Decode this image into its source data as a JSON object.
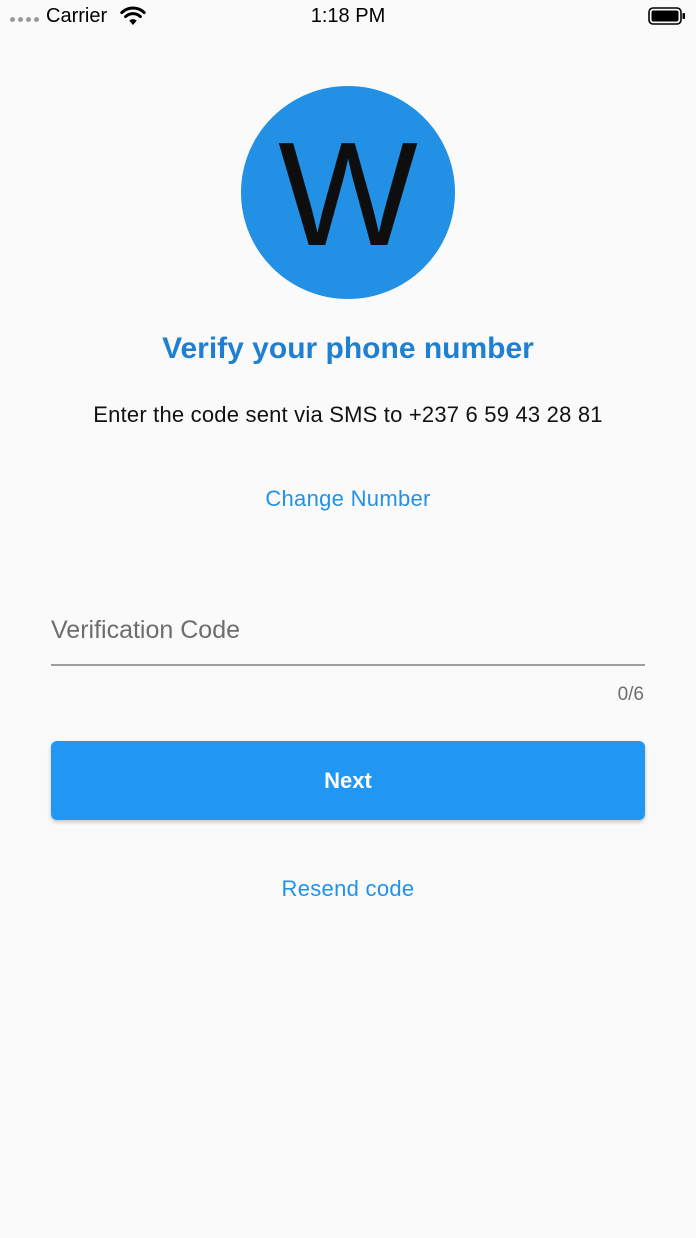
{
  "status_bar": {
    "carrier": "Carrier",
    "time": "1:18 PM",
    "icons": [
      "signal-dots-icon",
      "wifi-icon",
      "battery-icon"
    ]
  },
  "logo": {
    "letter": "W",
    "color": "#2291e5"
  },
  "verify": {
    "title": "Verify your phone number",
    "subtitle": "Enter the code sent via SMS to +237 6 59 43 28 81",
    "change_number": "Change Number"
  },
  "form": {
    "code_placeholder": "Verification Code",
    "code_value": "",
    "counter": "0/6",
    "next_label": "Next",
    "resend_label": "Resend code"
  },
  "colors": {
    "accent": "#2196f3",
    "title": "#1f7fd1",
    "link": "#2391e8",
    "background": "#fafafa"
  }
}
